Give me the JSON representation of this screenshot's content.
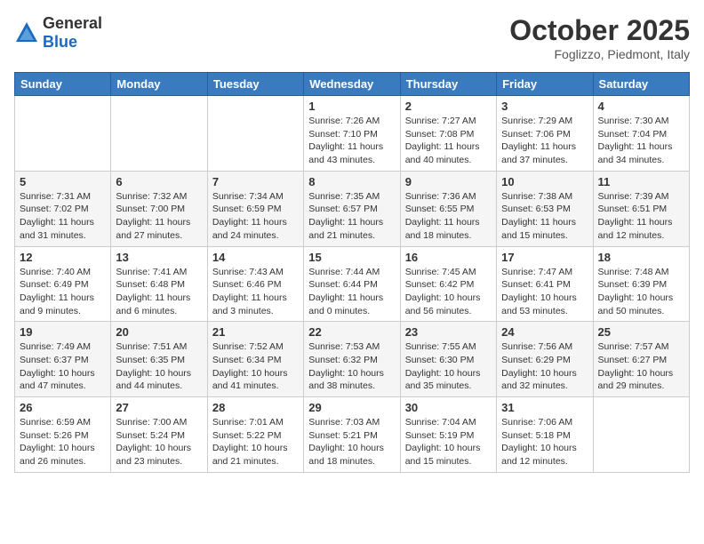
{
  "logo": {
    "general": "General",
    "blue": "Blue"
  },
  "header": {
    "month": "October 2025",
    "location": "Foglizzo, Piedmont, Italy"
  },
  "weekdays": [
    "Sunday",
    "Monday",
    "Tuesday",
    "Wednesday",
    "Thursday",
    "Friday",
    "Saturday"
  ],
  "weeks": [
    [
      {
        "day": "",
        "info": ""
      },
      {
        "day": "",
        "info": ""
      },
      {
        "day": "",
        "info": ""
      },
      {
        "day": "1",
        "info": "Sunrise: 7:26 AM\nSunset: 7:10 PM\nDaylight: 11 hours\nand 43 minutes."
      },
      {
        "day": "2",
        "info": "Sunrise: 7:27 AM\nSunset: 7:08 PM\nDaylight: 11 hours\nand 40 minutes."
      },
      {
        "day": "3",
        "info": "Sunrise: 7:29 AM\nSunset: 7:06 PM\nDaylight: 11 hours\nand 37 minutes."
      },
      {
        "day": "4",
        "info": "Sunrise: 7:30 AM\nSunset: 7:04 PM\nDaylight: 11 hours\nand 34 minutes."
      }
    ],
    [
      {
        "day": "5",
        "info": "Sunrise: 7:31 AM\nSunset: 7:02 PM\nDaylight: 11 hours\nand 31 minutes."
      },
      {
        "day": "6",
        "info": "Sunrise: 7:32 AM\nSunset: 7:00 PM\nDaylight: 11 hours\nand 27 minutes."
      },
      {
        "day": "7",
        "info": "Sunrise: 7:34 AM\nSunset: 6:59 PM\nDaylight: 11 hours\nand 24 minutes."
      },
      {
        "day": "8",
        "info": "Sunrise: 7:35 AM\nSunset: 6:57 PM\nDaylight: 11 hours\nand 21 minutes."
      },
      {
        "day": "9",
        "info": "Sunrise: 7:36 AM\nSunset: 6:55 PM\nDaylight: 11 hours\nand 18 minutes."
      },
      {
        "day": "10",
        "info": "Sunrise: 7:38 AM\nSunset: 6:53 PM\nDaylight: 11 hours\nand 15 minutes."
      },
      {
        "day": "11",
        "info": "Sunrise: 7:39 AM\nSunset: 6:51 PM\nDaylight: 11 hours\nand 12 minutes."
      }
    ],
    [
      {
        "day": "12",
        "info": "Sunrise: 7:40 AM\nSunset: 6:49 PM\nDaylight: 11 hours\nand 9 minutes."
      },
      {
        "day": "13",
        "info": "Sunrise: 7:41 AM\nSunset: 6:48 PM\nDaylight: 11 hours\nand 6 minutes."
      },
      {
        "day": "14",
        "info": "Sunrise: 7:43 AM\nSunset: 6:46 PM\nDaylight: 11 hours\nand 3 minutes."
      },
      {
        "day": "15",
        "info": "Sunrise: 7:44 AM\nSunset: 6:44 PM\nDaylight: 11 hours\nand 0 minutes."
      },
      {
        "day": "16",
        "info": "Sunrise: 7:45 AM\nSunset: 6:42 PM\nDaylight: 10 hours\nand 56 minutes."
      },
      {
        "day": "17",
        "info": "Sunrise: 7:47 AM\nSunset: 6:41 PM\nDaylight: 10 hours\nand 53 minutes."
      },
      {
        "day": "18",
        "info": "Sunrise: 7:48 AM\nSunset: 6:39 PM\nDaylight: 10 hours\nand 50 minutes."
      }
    ],
    [
      {
        "day": "19",
        "info": "Sunrise: 7:49 AM\nSunset: 6:37 PM\nDaylight: 10 hours\nand 47 minutes."
      },
      {
        "day": "20",
        "info": "Sunrise: 7:51 AM\nSunset: 6:35 PM\nDaylight: 10 hours\nand 44 minutes."
      },
      {
        "day": "21",
        "info": "Sunrise: 7:52 AM\nSunset: 6:34 PM\nDaylight: 10 hours\nand 41 minutes."
      },
      {
        "day": "22",
        "info": "Sunrise: 7:53 AM\nSunset: 6:32 PM\nDaylight: 10 hours\nand 38 minutes."
      },
      {
        "day": "23",
        "info": "Sunrise: 7:55 AM\nSunset: 6:30 PM\nDaylight: 10 hours\nand 35 minutes."
      },
      {
        "day": "24",
        "info": "Sunrise: 7:56 AM\nSunset: 6:29 PM\nDaylight: 10 hours\nand 32 minutes."
      },
      {
        "day": "25",
        "info": "Sunrise: 7:57 AM\nSunset: 6:27 PM\nDaylight: 10 hours\nand 29 minutes."
      }
    ],
    [
      {
        "day": "26",
        "info": "Sunrise: 6:59 AM\nSunset: 5:26 PM\nDaylight: 10 hours\nand 26 minutes."
      },
      {
        "day": "27",
        "info": "Sunrise: 7:00 AM\nSunset: 5:24 PM\nDaylight: 10 hours\nand 23 minutes."
      },
      {
        "day": "28",
        "info": "Sunrise: 7:01 AM\nSunset: 5:22 PM\nDaylight: 10 hours\nand 21 minutes."
      },
      {
        "day": "29",
        "info": "Sunrise: 7:03 AM\nSunset: 5:21 PM\nDaylight: 10 hours\nand 18 minutes."
      },
      {
        "day": "30",
        "info": "Sunrise: 7:04 AM\nSunset: 5:19 PM\nDaylight: 10 hours\nand 15 minutes."
      },
      {
        "day": "31",
        "info": "Sunrise: 7:06 AM\nSunset: 5:18 PM\nDaylight: 10 hours\nand 12 minutes."
      },
      {
        "day": "",
        "info": ""
      }
    ]
  ]
}
